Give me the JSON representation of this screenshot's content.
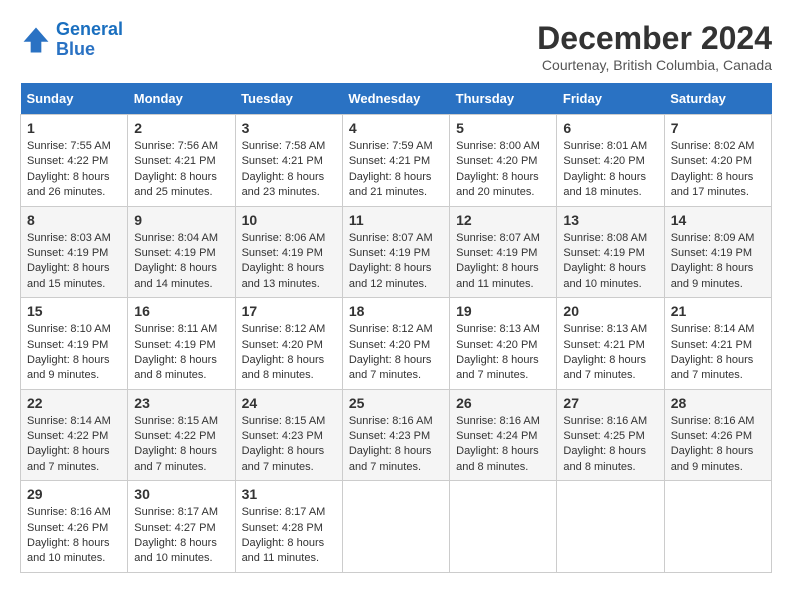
{
  "header": {
    "logo_line1": "General",
    "logo_line2": "Blue",
    "month_title": "December 2024",
    "location": "Courtenay, British Columbia, Canada"
  },
  "days_of_week": [
    "Sunday",
    "Monday",
    "Tuesday",
    "Wednesday",
    "Thursday",
    "Friday",
    "Saturday"
  ],
  "weeks": [
    [
      {
        "day": "1",
        "sunrise": "7:55 AM",
        "sunset": "4:22 PM",
        "daylight": "8 hours and 26 minutes."
      },
      {
        "day": "2",
        "sunrise": "7:56 AM",
        "sunset": "4:21 PM",
        "daylight": "8 hours and 25 minutes."
      },
      {
        "day": "3",
        "sunrise": "7:58 AM",
        "sunset": "4:21 PM",
        "daylight": "8 hours and 23 minutes."
      },
      {
        "day": "4",
        "sunrise": "7:59 AM",
        "sunset": "4:21 PM",
        "daylight": "8 hours and 21 minutes."
      },
      {
        "day": "5",
        "sunrise": "8:00 AM",
        "sunset": "4:20 PM",
        "daylight": "8 hours and 20 minutes."
      },
      {
        "day": "6",
        "sunrise": "8:01 AM",
        "sunset": "4:20 PM",
        "daylight": "8 hours and 18 minutes."
      },
      {
        "day": "7",
        "sunrise": "8:02 AM",
        "sunset": "4:20 PM",
        "daylight": "8 hours and 17 minutes."
      }
    ],
    [
      {
        "day": "8",
        "sunrise": "8:03 AM",
        "sunset": "4:19 PM",
        "daylight": "8 hours and 15 minutes."
      },
      {
        "day": "9",
        "sunrise": "8:04 AM",
        "sunset": "4:19 PM",
        "daylight": "8 hours and 14 minutes."
      },
      {
        "day": "10",
        "sunrise": "8:06 AM",
        "sunset": "4:19 PM",
        "daylight": "8 hours and 13 minutes."
      },
      {
        "day": "11",
        "sunrise": "8:07 AM",
        "sunset": "4:19 PM",
        "daylight": "8 hours and 12 minutes."
      },
      {
        "day": "12",
        "sunrise": "8:07 AM",
        "sunset": "4:19 PM",
        "daylight": "8 hours and 11 minutes."
      },
      {
        "day": "13",
        "sunrise": "8:08 AM",
        "sunset": "4:19 PM",
        "daylight": "8 hours and 10 minutes."
      },
      {
        "day": "14",
        "sunrise": "8:09 AM",
        "sunset": "4:19 PM",
        "daylight": "8 hours and 9 minutes."
      }
    ],
    [
      {
        "day": "15",
        "sunrise": "8:10 AM",
        "sunset": "4:19 PM",
        "daylight": "8 hours and 9 minutes."
      },
      {
        "day": "16",
        "sunrise": "8:11 AM",
        "sunset": "4:19 PM",
        "daylight": "8 hours and 8 minutes."
      },
      {
        "day": "17",
        "sunrise": "8:12 AM",
        "sunset": "4:20 PM",
        "daylight": "8 hours and 8 minutes."
      },
      {
        "day": "18",
        "sunrise": "8:12 AM",
        "sunset": "4:20 PM",
        "daylight": "8 hours and 7 minutes."
      },
      {
        "day": "19",
        "sunrise": "8:13 AM",
        "sunset": "4:20 PM",
        "daylight": "8 hours and 7 minutes."
      },
      {
        "day": "20",
        "sunrise": "8:13 AM",
        "sunset": "4:21 PM",
        "daylight": "8 hours and 7 minutes."
      },
      {
        "day": "21",
        "sunrise": "8:14 AM",
        "sunset": "4:21 PM",
        "daylight": "8 hours and 7 minutes."
      }
    ],
    [
      {
        "day": "22",
        "sunrise": "8:14 AM",
        "sunset": "4:22 PM",
        "daylight": "8 hours and 7 minutes."
      },
      {
        "day": "23",
        "sunrise": "8:15 AM",
        "sunset": "4:22 PM",
        "daylight": "8 hours and 7 minutes."
      },
      {
        "day": "24",
        "sunrise": "8:15 AM",
        "sunset": "4:23 PM",
        "daylight": "8 hours and 7 minutes."
      },
      {
        "day": "25",
        "sunrise": "8:16 AM",
        "sunset": "4:23 PM",
        "daylight": "8 hours and 7 minutes."
      },
      {
        "day": "26",
        "sunrise": "8:16 AM",
        "sunset": "4:24 PM",
        "daylight": "8 hours and 8 minutes."
      },
      {
        "day": "27",
        "sunrise": "8:16 AM",
        "sunset": "4:25 PM",
        "daylight": "8 hours and 8 minutes."
      },
      {
        "day": "28",
        "sunrise": "8:16 AM",
        "sunset": "4:26 PM",
        "daylight": "8 hours and 9 minutes."
      }
    ],
    [
      {
        "day": "29",
        "sunrise": "8:16 AM",
        "sunset": "4:26 PM",
        "daylight": "8 hours and 10 minutes."
      },
      {
        "day": "30",
        "sunrise": "8:17 AM",
        "sunset": "4:27 PM",
        "daylight": "8 hours and 10 minutes."
      },
      {
        "day": "31",
        "sunrise": "8:17 AM",
        "sunset": "4:28 PM",
        "daylight": "8 hours and 11 minutes."
      },
      null,
      null,
      null,
      null
    ]
  ]
}
